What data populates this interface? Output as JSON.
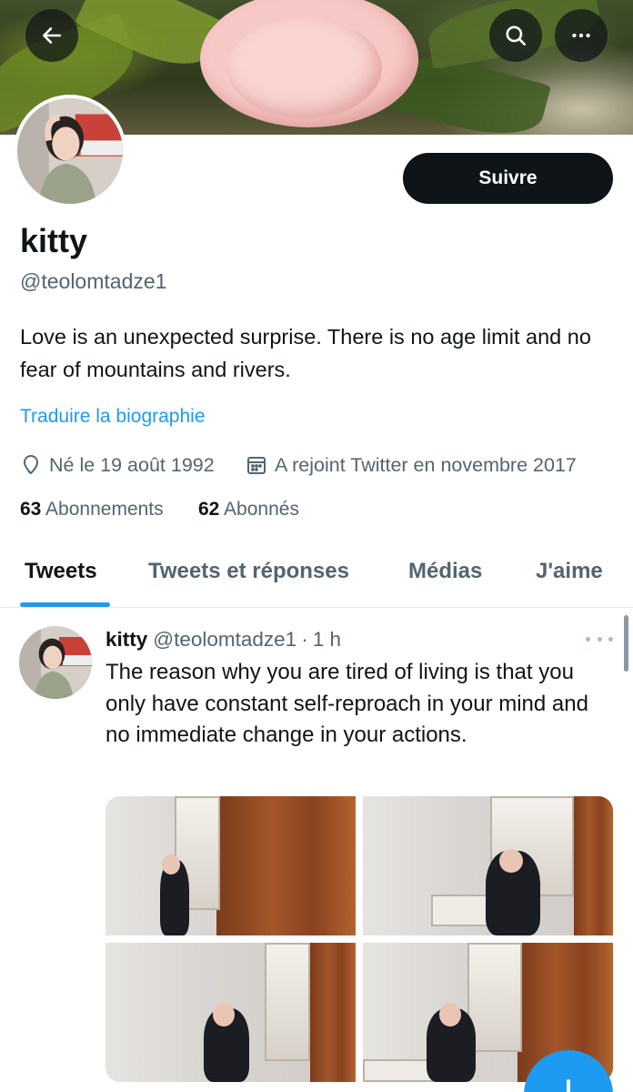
{
  "profile": {
    "name": "kitty",
    "handle": "@teolomtadze1",
    "bio": "Love is an unexpected surprise. There is no age limit and no fear of mountains and rivers.",
    "translate_label": "Traduire la biographie",
    "birth": "Né le 19 août 1992",
    "joined": "A rejoint Twitter en novembre 2017",
    "following_count": "63",
    "following_label": "Abonnements",
    "followers_count": "62",
    "followers_label": "Abonnés",
    "follow_label": "Suivre"
  },
  "tabs": [
    {
      "label": "Tweets",
      "active": true
    },
    {
      "label": "Tweets et réponses",
      "active": false
    },
    {
      "label": "Médias",
      "active": false
    },
    {
      "label": "J'aime",
      "active": false
    }
  ],
  "tweet": {
    "name": "kitty",
    "handle": "@teolomtadze1",
    "separator": "·",
    "time": "1 h",
    "text": "The reason why you are tired of living is that you only have constant self-reproach in your mind and no immediate change in your actions."
  },
  "icons": {
    "back": "arrow-left-icon",
    "search": "search-icon",
    "more": "more-horizontal-icon",
    "birth": "location-pin-icon",
    "joined": "calendar-icon",
    "compose": "plus-icon"
  },
  "colors": {
    "accent": "#1d9bf0",
    "text_primary": "#0f1419",
    "text_secondary": "#536471",
    "follow_button": "#0f1419"
  }
}
